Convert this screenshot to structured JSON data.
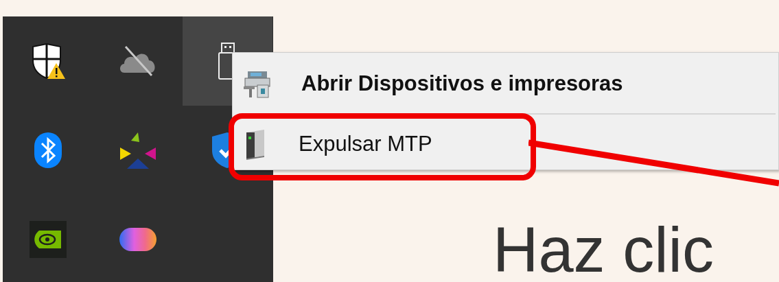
{
  "tray": {
    "icons": [
      {
        "kind": "shield-warning",
        "selected": false
      },
      {
        "kind": "cloud-off",
        "selected": false
      },
      {
        "kind": "usb-drive",
        "selected": true
      },
      {
        "kind": "bluetooth",
        "selected": false
      },
      {
        "kind": "triangles",
        "selected": false
      },
      {
        "kind": "shield-check",
        "selected": false
      },
      {
        "kind": "eye-chip",
        "selected": false
      },
      {
        "kind": "color-blob",
        "selected": false
      }
    ]
  },
  "context_menu": {
    "items": [
      {
        "kind": "printer",
        "label": "Abrir Dispositivos e impresoras",
        "bold": true,
        "marked": false
      },
      {
        "kind": "drive",
        "label": "Expulsar MTP",
        "bold": false,
        "marked": true
      }
    ]
  },
  "headline": "Haz clic"
}
